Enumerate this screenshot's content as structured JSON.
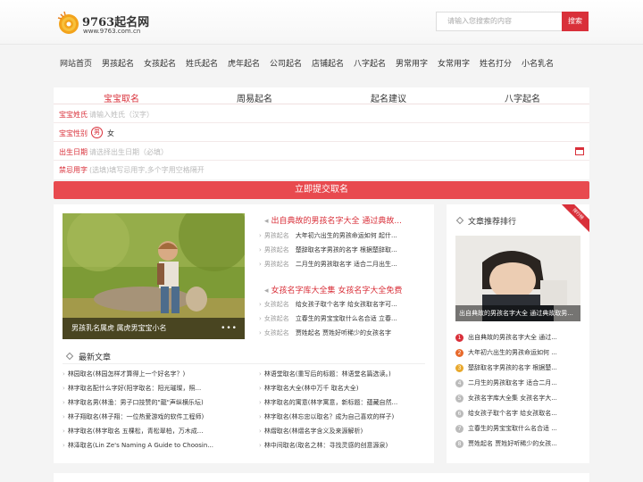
{
  "colors": {
    "accent": "#d9303a",
    "submit": "#e84a4f"
  },
  "logo": {
    "name": "9763起名网",
    "url": "www.9763.com.cn"
  },
  "search": {
    "placeholder": "请输入您搜索的内容",
    "button": "搜索"
  },
  "nav": [
    "网站首页",
    "男孩起名",
    "女孩起名",
    "姓氏起名",
    "虎年起名",
    "公司起名",
    "店铺起名",
    "八字起名",
    "男常用字",
    "女常用字",
    "姓名打分",
    "小名乳名"
  ],
  "form": {
    "tabs": [
      "宝宝取名",
      "周易起名",
      "起名建议",
      "八字起名"
    ],
    "surname_label": "宝宝姓氏",
    "surname_placeholder": "请输入姓氏（汉字）",
    "gender_label": "宝宝性别",
    "gender_male": "男",
    "gender_female": "女",
    "birth_label": "出生日期",
    "birth_placeholder": "请选择出生日期（必填）",
    "forbid_label": "禁忌用字",
    "forbid_placeholder": "(选填)填写忌用字,多个字用空格隔开",
    "submit": "立即提交取名"
  },
  "feature": {
    "caption": "男孩乳名属虎 属虎男宝宝小名",
    "dots": "•••"
  },
  "news": [
    {
      "title": "出自典故的男孩名字大全 通过典故...",
      "items": [
        {
          "cat": "男孩起名",
          "text": "大年初六出生的男孩命运如何 起什..."
        },
        {
          "cat": "男孩起名",
          "text": "楚辞取名字男孩的名字 根据楚辞取..."
        },
        {
          "cat": "男孩起名",
          "text": "二月生的男孩取名字 适合二月出生..."
        }
      ]
    },
    {
      "title": "女孩名字库大全集 女孩名字大全免费",
      "items": [
        {
          "cat": "女孩起名",
          "text": "给女孩子取个名字 给女孩取名字可..."
        },
        {
          "cat": "女孩起名",
          "text": "立春生的男宝宝取什么名合适 立春..."
        },
        {
          "cat": "女孩起名",
          "text": "贾姓起名 贾姓好听稀少的女孩名字"
        }
      ]
    }
  ],
  "latest": {
    "title": "最新文章",
    "left": [
      "林园取名(林园怎样才算得上一个好名字？)",
      "林字取名配什么字好(阳字取名：阳光璀璨，照...",
      "林字取名男(林渔：男子口技赞的\"龍\"声纵横乐坛)",
      "林子翔取名(林子翔：一位热爱游戏的软件工程师)",
      "林字取名(林字取名 五棵松，青松翠柏，万木成...",
      "林泽取名(Lin Ze's Naming A Guide to Choosin..."
    ],
    "right": [
      "林语堂取名(重写后的标题：林语堂名篇选读。)",
      "林字取名大全(林中万千 取名大全)",
      "林字取名的寓意(林字寓意，新标题：蕴藏自然...",
      "林字取名(林忘忠以取名？成为自己喜欢的样子)",
      "林熠取名(林熠名字含义及来源解析)",
      "林中间取名(取名之林：寻找灵感的创意源泉)"
    ]
  },
  "sidebar": {
    "title": "文章推荐排行",
    "ribbon": "排行榜",
    "photo_caption": "出自典故的男孩名字大全 通过典故取男...",
    "rank": [
      {
        "n": "1",
        "text": "出自典故的男孩名字大全 通过..."
      },
      {
        "n": "2",
        "text": "大年初六出生的男孩命运如何 ..."
      },
      {
        "n": "3",
        "text": "楚辞取名字男孩的名字 根据楚..."
      },
      {
        "n": "4",
        "text": "二月生的男孩取名字 适合二月..."
      },
      {
        "n": "5",
        "text": "女孩名字库大全集 女孩名字大..."
      },
      {
        "n": "6",
        "text": "给女孩子取个名字 给女孩取名..."
      },
      {
        "n": "7",
        "text": "立春生的男宝宝取什么名合适 ..."
      },
      {
        "n": "8",
        "text": "贾姓起名 贾姓好听稀少的女孩..."
      }
    ]
  }
}
